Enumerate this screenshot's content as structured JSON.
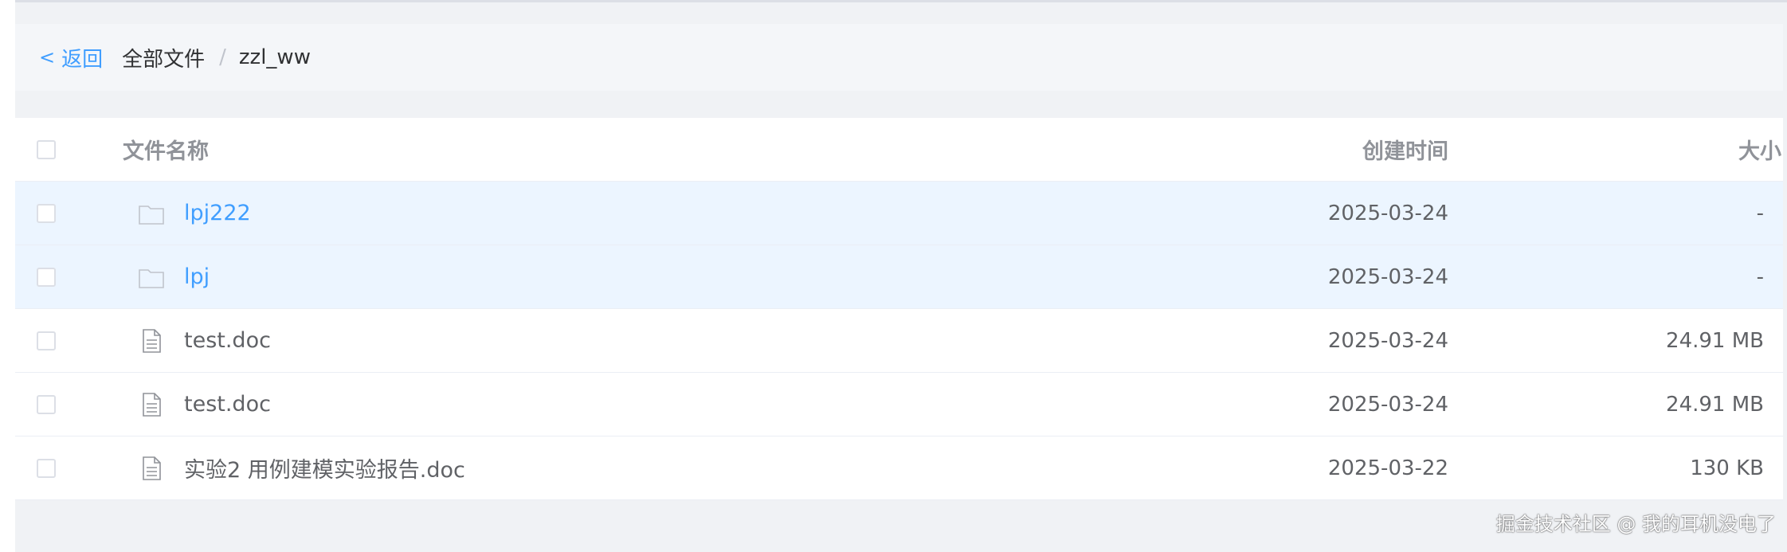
{
  "breadcrumb": {
    "back_chevron": "<",
    "back_label": "返回",
    "root_label": "全部文件",
    "separator": "/",
    "current_label": "zzl_ww"
  },
  "table": {
    "headers": {
      "name": "文件名称",
      "created": "创建时间",
      "size": "大小"
    },
    "rows": [
      {
        "name": "lpj222",
        "created": "2025-03-24",
        "size": "-",
        "type": "folder",
        "icon": "folder-icon"
      },
      {
        "name": "lpj",
        "created": "2025-03-24",
        "size": "-",
        "type": "folder",
        "icon": "folder-icon"
      },
      {
        "name": "test.doc",
        "created": "2025-03-24",
        "size": "24.91 MB",
        "type": "file",
        "icon": "document-icon"
      },
      {
        "name": "test.doc",
        "created": "2025-03-24",
        "size": "24.91 MB",
        "type": "file",
        "icon": "document-icon"
      },
      {
        "name": "实验2 用例建模实验报告.doc",
        "created": "2025-03-22",
        "size": "130 KB",
        "type": "file",
        "icon": "document-icon"
      }
    ]
  },
  "watermark": "掘金技术社区 @ 我的耳机没电了",
  "colors": {
    "accent": "#409eff",
    "folder_row_bg": "#ecf5ff",
    "page_bg": "#f0f2f5"
  }
}
